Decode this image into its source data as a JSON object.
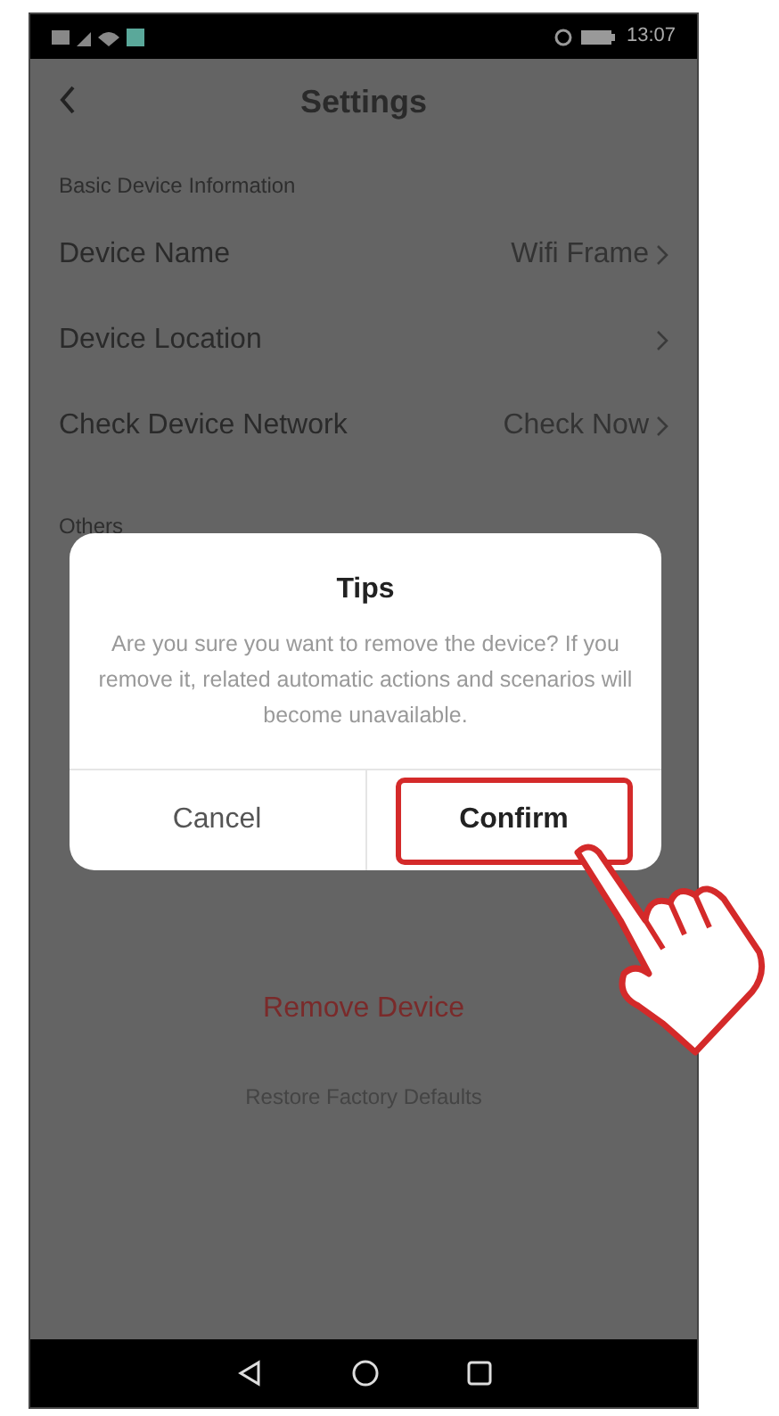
{
  "status_bar": {
    "time": "13:07"
  },
  "header": {
    "title": "Settings"
  },
  "sections": [
    {
      "label": "Basic Device Information",
      "rows": [
        {
          "label": "Device Name",
          "value": "Wifi Frame"
        },
        {
          "label": "Device Location"
        },
        {
          "label": "Check Device Network",
          "value": "Check Now"
        }
      ]
    },
    {
      "label": "Others"
    }
  ],
  "actions": [
    {
      "label": "Remove Device",
      "kind": "danger"
    },
    {
      "label": "Restore Factory Defaults",
      "kind": "plain"
    }
  ],
  "dialog": {
    "title": "Tips",
    "message": "Are you sure you want to remove the device? If you remove it, related automatic actions and scenarios will become unavailable.",
    "buttons": [
      {
        "label": "Cancel",
        "highlighted": false
      },
      {
        "label": "Confirm",
        "highlighted": true
      }
    ]
  }
}
